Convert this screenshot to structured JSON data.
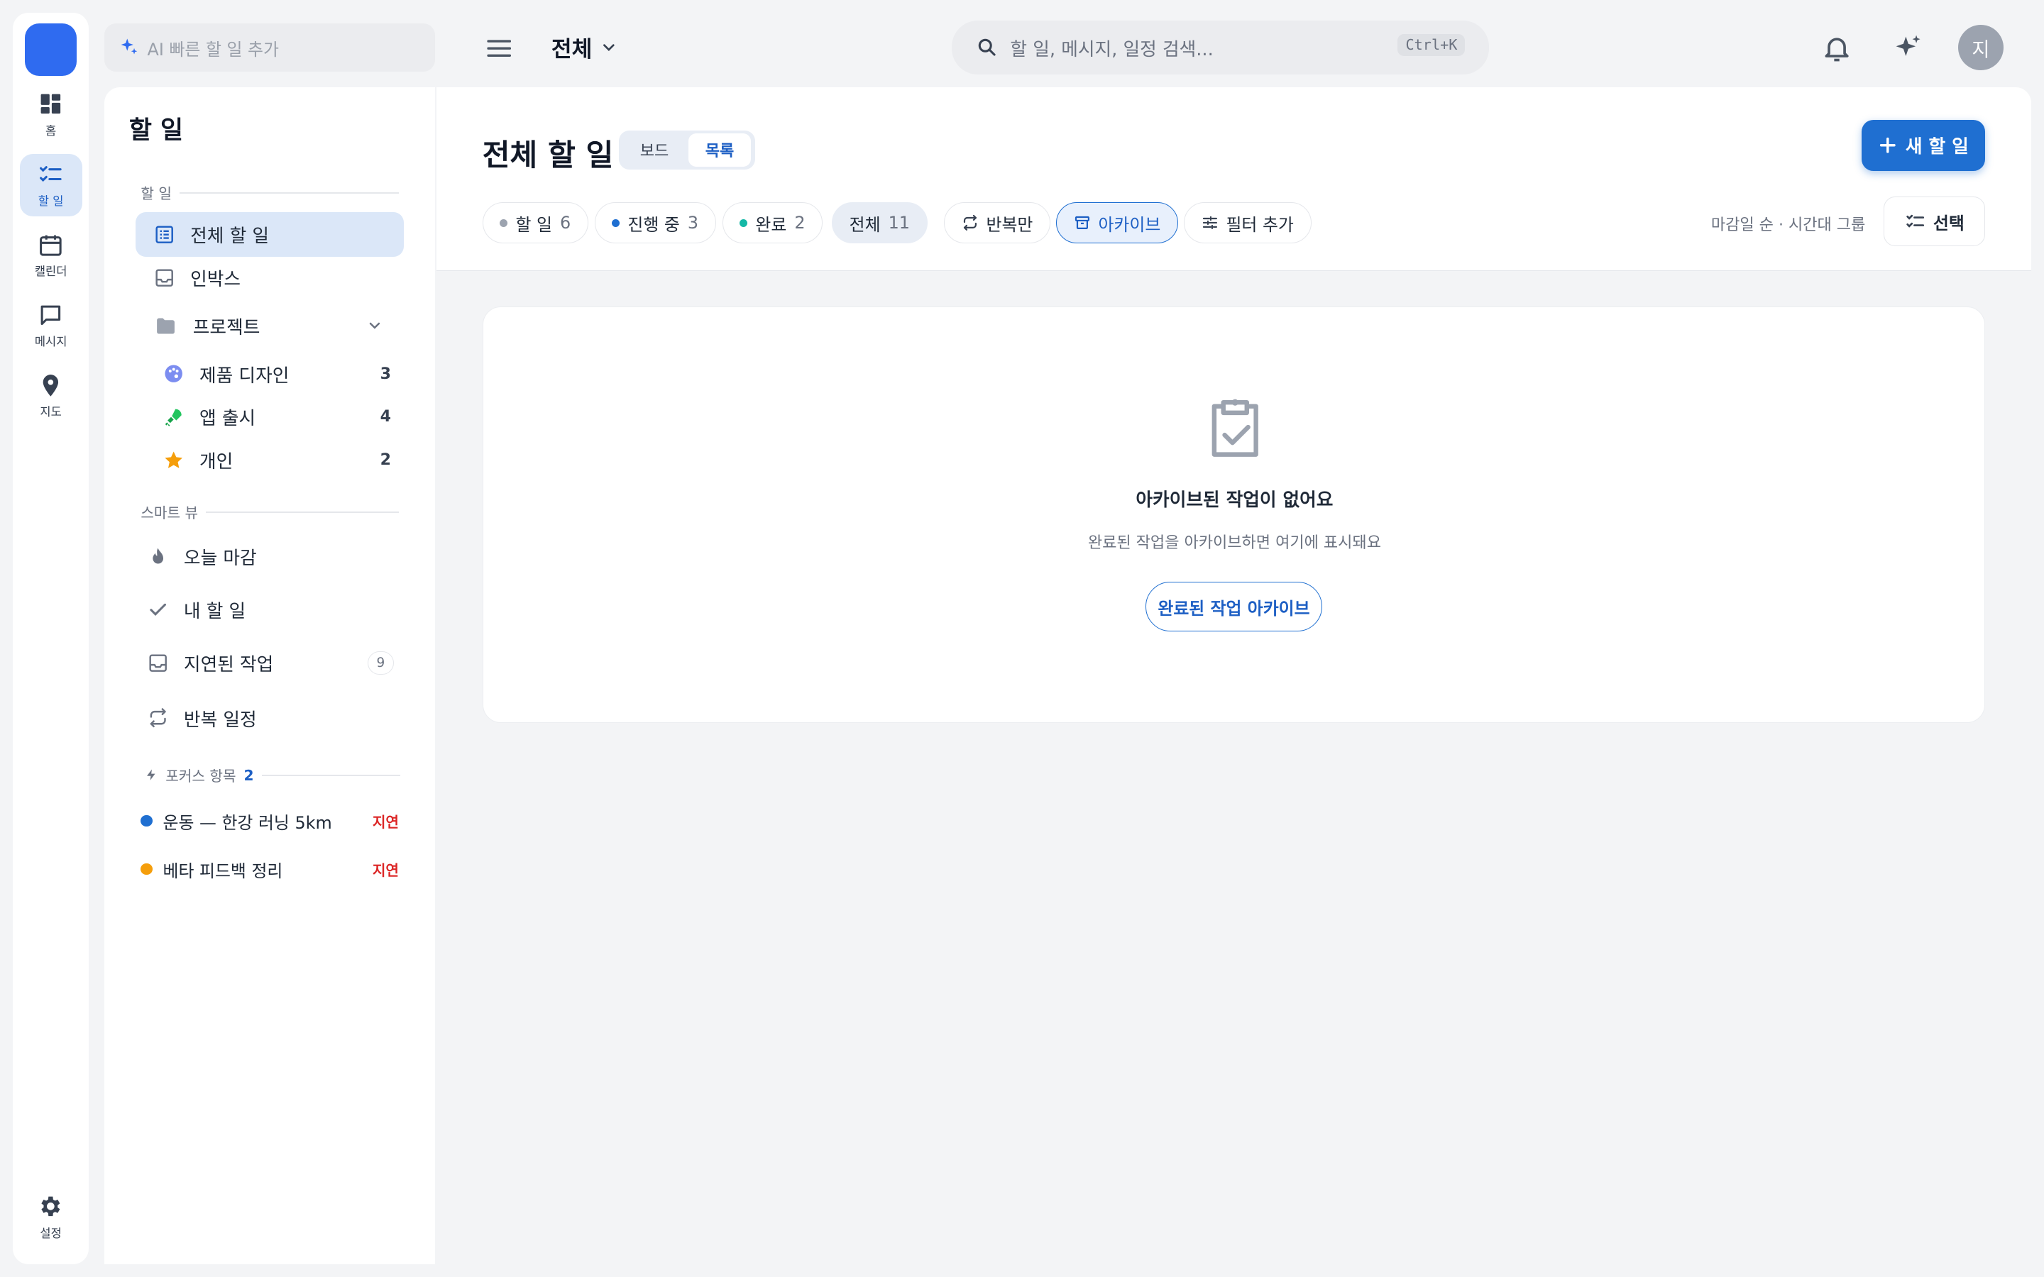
{
  "rail": {
    "items": [
      {
        "label": "홈",
        "icon": "dashboard-icon"
      },
      {
        "label": "할 일",
        "icon": "checklist-icon"
      },
      {
        "label": "캘린더",
        "icon": "calendar-icon"
      },
      {
        "label": "메시지",
        "icon": "message-icon"
      },
      {
        "label": "지도",
        "icon": "map-pin-icon"
      }
    ],
    "settings_label": "설정"
  },
  "topbar": {
    "ai_placeholder": "AI 빠른 할 일 추가",
    "scope_label": "전체",
    "search_placeholder": "할 일, 메시지, 일정 검색...",
    "search_shortcut": "Ctrl+K",
    "avatar_initial": "지"
  },
  "sidebar": {
    "title": "할 일",
    "section_tasks": "할 일",
    "all_tasks": "전체 할 일",
    "inbox": "인박스",
    "projects_label": "프로젝트",
    "projects": [
      {
        "name": "제품 디자인",
        "count": "3"
      },
      {
        "name": "앱 출시",
        "count": "4"
      },
      {
        "name": "개인",
        "count": "2"
      }
    ],
    "section_smart": "스마트 뷰",
    "smart": {
      "today": "오늘 마감",
      "mine": "내 할 일",
      "overdue": "지연된 작업",
      "overdue_count": "9",
      "recurring": "반복 일정"
    },
    "section_focus": "포커스 항목",
    "focus_count": "2",
    "focus": [
      {
        "name": "운동 — 한강 러닝 5km",
        "status": "지연",
        "color": "#1f6fd1"
      },
      {
        "name": "베타 피드백 정리",
        "status": "지연",
        "color": "#f59e0b"
      }
    ]
  },
  "main": {
    "title": "전체 할 일",
    "view_board": "보드",
    "view_list": "목록",
    "new_task": "새 할 일",
    "filters": {
      "todo": {
        "label": "할 일",
        "count": "6"
      },
      "progress": {
        "label": "진행 중",
        "count": "3"
      },
      "done": {
        "label": "완료",
        "count": "2"
      },
      "all": {
        "label": "전체",
        "count": "11"
      },
      "recurring_only": "반복만",
      "archive": "아카이브",
      "add_filter": "필터 추가"
    },
    "sort_text": "마감일 순 · 시간대 그룹",
    "select_label": "선택",
    "empty": {
      "title": "아카이브된 작업이 없어요",
      "subtitle": "완료된 작업을 아카이브하면 여기에 표시돼요",
      "action": "완료된 작업 아카이브"
    }
  }
}
